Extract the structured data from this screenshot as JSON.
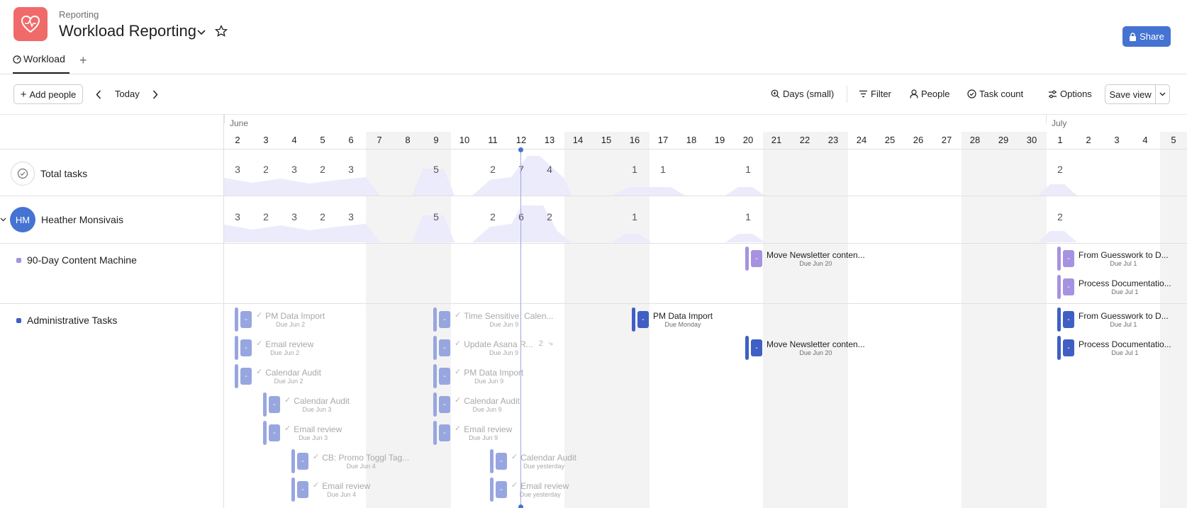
{
  "header": {
    "breadcrumb": "Reporting",
    "title": "Workload Reporting",
    "share_label": "Share"
  },
  "tabs": [
    {
      "label": "Workload",
      "icon": "workload-icon"
    }
  ],
  "toolbar": {
    "add_people": "Add people",
    "today": "Today",
    "days": "Days (small)",
    "filter": "Filter",
    "people": "People",
    "task_count": "Task count",
    "options": "Options",
    "save_view": "Save view"
  },
  "months": [
    "June",
    "July"
  ],
  "days": [
    "2",
    "3",
    "4",
    "5",
    "6",
    "7",
    "8",
    "9",
    "10",
    "11",
    "12",
    "13",
    "14",
    "15",
    "16",
    "17",
    "18",
    "19",
    "20",
    "21",
    "22",
    "23",
    "24",
    "25",
    "26",
    "27",
    "28",
    "29",
    "30",
    "1",
    "2",
    "3",
    "4",
    "5"
  ],
  "rows": {
    "total": {
      "label": "Total tasks",
      "counts": [
        "3",
        "2",
        "3",
        "2",
        "3",
        "",
        "",
        "5",
        "",
        "2",
        "7",
        "4",
        "",
        "",
        "1",
        "1",
        "",
        "",
        "1",
        "",
        "",
        "",
        "",
        "",
        "",
        "",
        "",
        "",
        "",
        "2",
        "",
        "",
        "",
        ""
      ]
    },
    "person": {
      "initials": "HM",
      "label": "Heather Monsivais",
      "counts": [
        "3",
        "2",
        "3",
        "2",
        "3",
        "",
        "",
        "5",
        "",
        "2",
        "6",
        "2",
        "",
        "",
        "1",
        "",
        "",
        "",
        "1",
        "",
        "",
        "",
        "",
        "",
        "",
        "",
        "",
        "",
        "",
        "2",
        "",
        "",
        "",
        ""
      ]
    },
    "projects": [
      {
        "label": "90-Day Content Machine",
        "color": "#a692e0"
      },
      {
        "label": "Administrative Tasks",
        "color": "#3f5fc4"
      }
    ]
  },
  "tasks": {
    "content_machine": [
      {
        "name": "Move Newsletter conten...",
        "due": "Due Jun 20"
      },
      {
        "name": "From Guesswork to D...",
        "due": "Due Jul 1"
      },
      {
        "name": "Process Documentatio...",
        "due": "Due Jul 1"
      }
    ],
    "admin": [
      {
        "name": "PM Data Import",
        "due": "Due Jun 2"
      },
      {
        "name": "Email review",
        "due": "Due Jun 2"
      },
      {
        "name": "Calendar Audit",
        "due": "Due Jun 2"
      },
      {
        "name": "Calendar Audit",
        "due": "Due Jun 3"
      },
      {
        "name": "Email review",
        "due": "Due Jun 3"
      },
      {
        "name": "CB: Promo Toggl Tag...",
        "due": "Due Jun 4"
      },
      {
        "name": "Email review",
        "due": "Due Jun 4"
      },
      {
        "name": "Time Sensitive: Calen...",
        "due": "Due Jun 9"
      },
      {
        "name": "Update Asana R...",
        "due": "Due Jun 9",
        "subtasks": "2"
      },
      {
        "name": "PM Data Import",
        "due": "Due Jun 9"
      },
      {
        "name": "Calendar Audit",
        "due": "Due Jun 9"
      },
      {
        "name": "Email review",
        "due": "Due Jun 9"
      },
      {
        "name": "Calendar Audit",
        "due": "Due yesterday"
      },
      {
        "name": "Email review",
        "due": "Due yesterday"
      },
      {
        "name": "PM Data Import",
        "due": "Due Monday"
      },
      {
        "name": "Move Newsletter conten...",
        "due": "Due Jun 20"
      },
      {
        "name": "From Guesswork to D...",
        "due": "Due Jul 1"
      },
      {
        "name": "Process Documentatio...",
        "due": "Due Jul 1"
      }
    ]
  },
  "colors": {
    "brand": "#f06a6a",
    "share": "#4573d2",
    "task_blue": "#3f5fc4",
    "task_faded": "#98a6e0",
    "task_purple": "#a692e0",
    "workload_fill": "#ecebfb"
  }
}
